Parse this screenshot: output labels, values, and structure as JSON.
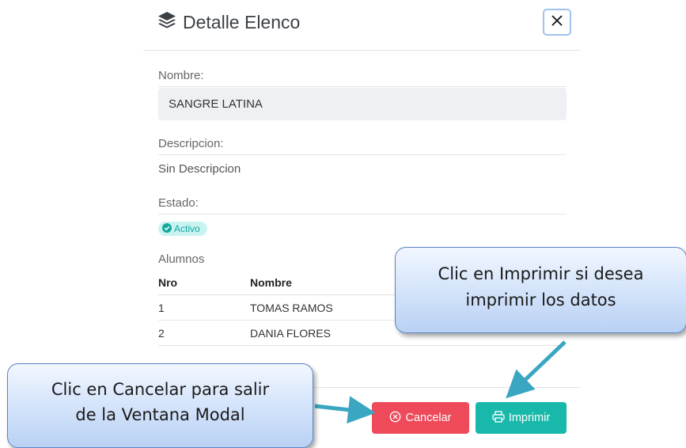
{
  "modal": {
    "title": "Detalle Elenco",
    "fields": {
      "nombre_label": "Nombre:",
      "nombre_value": "SANGRE LATINA",
      "descripcion_label": "Descripcion:",
      "descripcion_value": "Sin Descripcion",
      "estado_label": "Estado:",
      "estado_badge": "Activo"
    },
    "alumnos": {
      "label": "Alumnos",
      "columns": [
        "Nro",
        "Nombre"
      ],
      "rows": [
        [
          "1",
          "TOMAS RAMOS"
        ],
        [
          "2",
          "DANIA FLORES"
        ]
      ]
    },
    "footer": {
      "cancel_label": "Cancelar",
      "print_label": "Imprimir"
    }
  },
  "callouts": {
    "print": [
      "Clic en Imprimir si desea",
      "imprimir los datos"
    ],
    "cancel": [
      "Clic en Cancelar para salir",
      "de la Ventana Modal"
    ]
  },
  "colors": {
    "cancel": "#ee4a5a",
    "print": "#18b8ab",
    "badge_bg": "#c9f3f1",
    "badge_text": "#13a8a0",
    "arrow": "#3aa6c2"
  },
  "icons": {
    "title": "layers-icon",
    "close": "close-icon",
    "badge": "check-circle-icon",
    "cancel": "x-circle-icon",
    "print": "printer-icon"
  }
}
